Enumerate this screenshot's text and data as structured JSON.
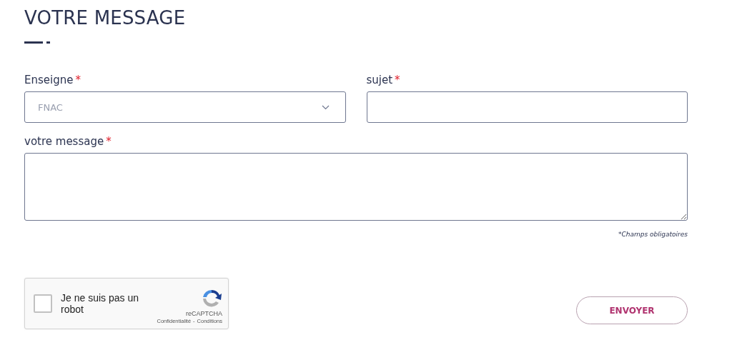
{
  "title": "VOTRE MESSAGE",
  "fields": [
    {
      "kind": "select",
      "label": "Enseigne",
      "required_mark": "*",
      "value": "FNAC"
    },
    {
      "kind": "text",
      "label": "sujet",
      "required_mark": "*"
    },
    {
      "kind": "textarea",
      "label": "votre message",
      "required_mark": "*"
    }
  ],
  "required_note": "*Champs obligatoires",
  "captcha": {
    "checked": false,
    "label": "Je ne suis pas un robot",
    "brand": "reCAPTCHA",
    "privacy": "Confidentialité",
    "separator": "-",
    "terms": "Conditions"
  },
  "submit": "ENVOYER"
}
